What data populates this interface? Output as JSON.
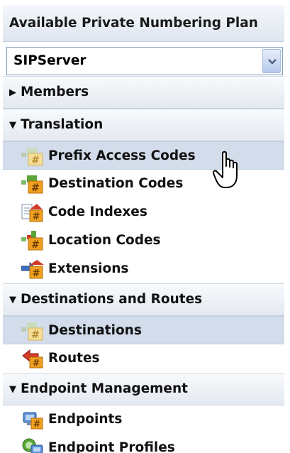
{
  "header": {
    "title": "Available Private Numbering Plan"
  },
  "plan_select": {
    "value": "SIPServer"
  },
  "sections": {
    "members": {
      "label": "Members",
      "state": "collapsed"
    },
    "translation": {
      "label": "Translation",
      "state": "expanded"
    },
    "destinations_routes": {
      "label": "Destinations and Routes",
      "state": "expanded"
    },
    "endpoint_management": {
      "label": "Endpoint Management",
      "state": "expanded"
    }
  },
  "items": {
    "prefix_access_codes": {
      "label": "Prefix Access Codes",
      "icon": "prefix-code-icon"
    },
    "destination_codes": {
      "label": "Destination Codes",
      "icon": "destination-code-icon"
    },
    "code_indexes": {
      "label": "Code Indexes",
      "icon": "code-index-icon"
    },
    "location_codes": {
      "label": "Location Codes",
      "icon": "location-code-icon"
    },
    "extensions": {
      "label": "Extensions",
      "icon": "extension-icon"
    },
    "destinations": {
      "label": "Destinations",
      "icon": "destination-icon"
    },
    "routes": {
      "label": "Routes",
      "icon": "route-icon"
    },
    "endpoints": {
      "label": "Endpoints",
      "icon": "endpoint-icon"
    },
    "endpoint_profiles": {
      "label": "Endpoint Profiles",
      "icon": "endpoint-profile-icon"
    }
  },
  "colors": {
    "selected_row": "#d3dcea",
    "section_header": "#e3e9f0",
    "icon_orange": "#f0a020",
    "icon_green": "#5aa538",
    "icon_red": "#d33a2a"
  }
}
